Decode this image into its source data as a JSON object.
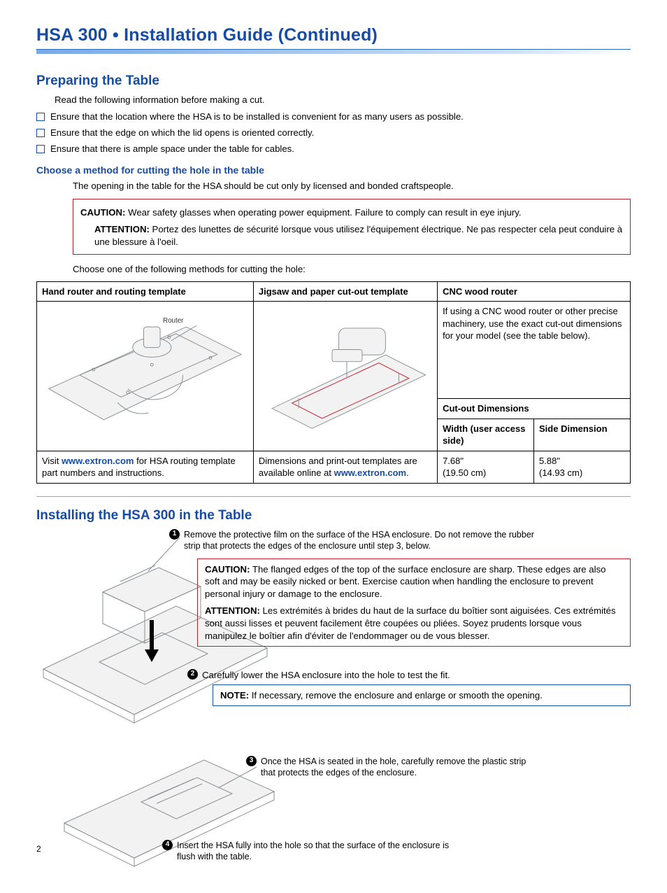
{
  "page_number": "2",
  "doc_title": "HSA 300 • Installation Guide (Continued)",
  "s1": {
    "heading": "Preparing the Table",
    "intro": "Read the following information before making a cut.",
    "chk1": "Ensure that the location where the HSA is to be installed is convenient for as many users as possible.",
    "chk2": "Ensure that the edge on which the lid opens is oriented correctly.",
    "chk3": "Ensure that there is ample space under the table for cables.",
    "sub": "Choose a method for cutting the hole in the table",
    "sub_intro": "The opening in the table for the HSA should be cut only by licensed and bonded craftspeople.",
    "caution_lbl": "CAUTION:",
    "caution_txt": "  Wear safety glasses when operating power equipment. Failure to comply can result in eye injury.",
    "attention_lbl": "ATTENTION:",
    "attention_txt": "  Portez des lunettes de sécurité lorsque vous utilisez l'équipement électrique. Ne pas respecter cela peut conduire à une blessure à l'oeil.",
    "choose": "Choose one of the following methods for cutting the hole:"
  },
  "table": {
    "h1": "Hand router and routing template",
    "h2": "Jigsaw and paper cut-out template",
    "h3": "CNC wood router",
    "cnc_text": "If using a CNC wood router or other precise machinery, use the exact cut-out dimensions for your model (see the table below).",
    "cut_hdr": "Cut-out Dimensions",
    "width_hdr": "Width (user access side)",
    "side_hdr": "Side Dimension",
    "width_val": "7.68\"",
    "width_cm": "(19.50 cm)",
    "side_val": "5.88\"",
    "side_cm": "(14.93 cm)",
    "visit_pre": "Visit ",
    "link": "www.extron.com",
    "visit_post": " for HSA routing template part numbers and instructions.",
    "dim_pre": "Dimensions and print-out templates are available online at ",
    "dim_post": ".",
    "router_label": "Router"
  },
  "s2": {
    "heading": "Installing the HSA 300 in the Table",
    "step1": "Remove the protective film on the surface of the HSA enclosure. Do not remove the rubber strip that protects the edges of the enclosure until step 3, below.",
    "c_lbl": "CAUTION:",
    "c_txt": " The flanged edges of the top of the surface enclosure are sharp. These edges are also soft and may be easily nicked or bent. Exercise caution when handling the enclosure to prevent personal injury or damage to the enclosure.",
    "a_lbl": "ATTENTION:",
    "a_txt": " Les extrémités à brides du haut de la surface du boîtier sont aiguisées. Ces extrémités sont aussi lisses et peuvent facilement être coupées ou pliées. Soyez prudents lorsque vous manipulez le boîtier afin d'éviter de l'endommager ou de vous blesser.",
    "step2": "Carefully lower the HSA enclosure into the hole to test the fit.",
    "note_lbl": "NOTE:",
    "note_txt": "   If necessary, remove the enclosure and enlarge or smooth the opening.",
    "step3": "Once the HSA is seated in the hole, carefully remove the plastic strip that protects the edges of the enclosure.",
    "step4": "Insert the HSA fully into the hole so that the surface of the enclosure is flush with the table."
  }
}
